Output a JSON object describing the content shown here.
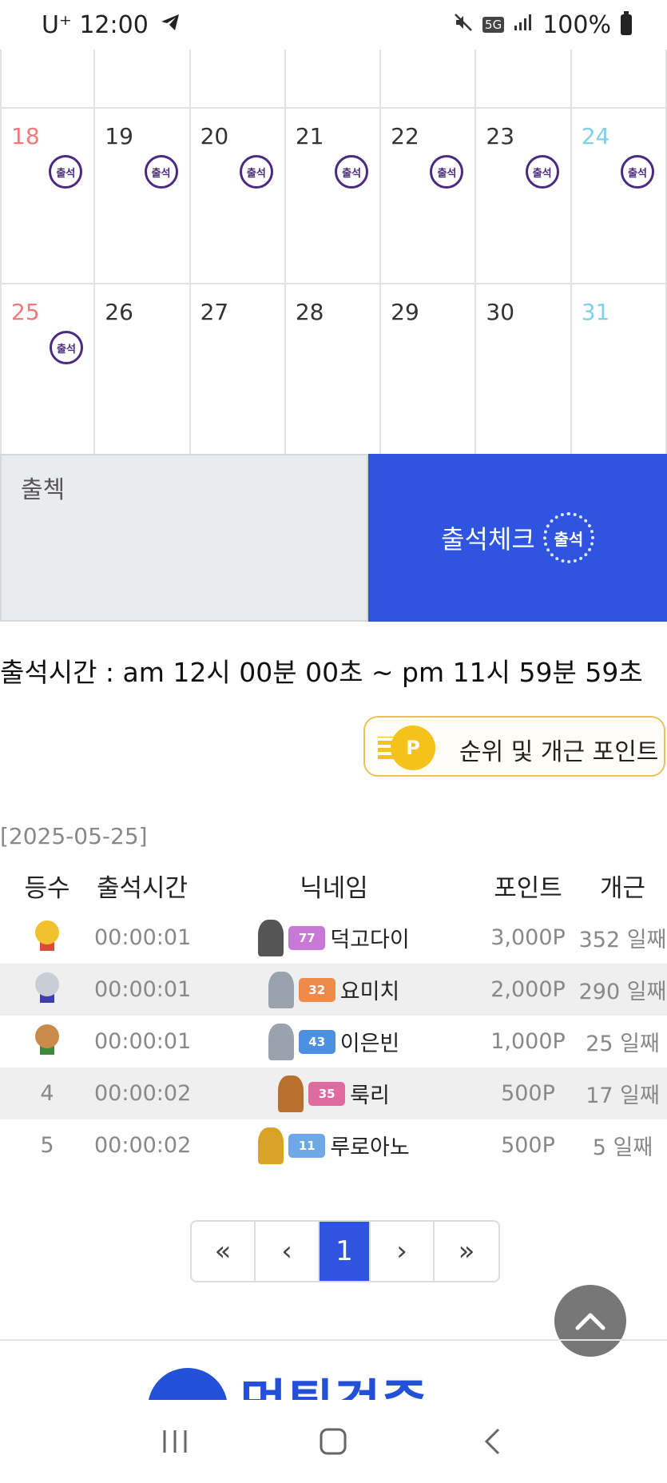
{
  "status_bar": {
    "carrier": "U⁺ 12:00",
    "network": "5G",
    "battery": "100%"
  },
  "calendar": {
    "week_a": [
      {
        "day": "18",
        "kind": "sun",
        "stamp": true
      },
      {
        "day": "19",
        "kind": "weekday",
        "stamp": true
      },
      {
        "day": "20",
        "kind": "weekday",
        "stamp": true
      },
      {
        "day": "21",
        "kind": "weekday",
        "stamp": true
      },
      {
        "day": "22",
        "kind": "weekday",
        "stamp": true
      },
      {
        "day": "23",
        "kind": "weekday",
        "stamp": true
      },
      {
        "day": "24",
        "kind": "sat",
        "stamp": true
      }
    ],
    "week_b": [
      {
        "day": "25",
        "kind": "sun",
        "stamp": true
      },
      {
        "day": "26",
        "kind": "weekday",
        "stamp": false
      },
      {
        "day": "27",
        "kind": "weekday",
        "stamp": false
      },
      {
        "day": "28",
        "kind": "weekday",
        "stamp": false
      },
      {
        "day": "29",
        "kind": "weekday",
        "stamp": false
      },
      {
        "day": "30",
        "kind": "weekday",
        "stamp": false
      },
      {
        "day": "31",
        "kind": "sat",
        "stamp": false
      }
    ],
    "stamp_text": "출석"
  },
  "attendance": {
    "input_value": "출첵",
    "button_label": "출석체크",
    "seal_text": "출석"
  },
  "time_note": "출석시간 : am 12시 00분 00초 ~ pm 11시 59분 59초",
  "rank_button": {
    "label": "순위 및 개근 포인트",
    "coin_letter": "P"
  },
  "date_label": "[2025-05-25]",
  "table": {
    "headers": {
      "rank": "등수",
      "time": "출석시간",
      "nickname": "닉네임",
      "points": "포인트",
      "days": "개근"
    },
    "rows": [
      {
        "rank": "1",
        "medal": "gold",
        "time": "00:00:01",
        "level": "77",
        "level_color": "#c879d8",
        "nickname": "덕고다이",
        "points": "3,000P",
        "days": "352 일째",
        "avatar": "#555555"
      },
      {
        "rank": "2",
        "medal": "silver",
        "time": "00:00:01",
        "level": "32",
        "level_color": "#ef8a4a",
        "nickname": "요미치",
        "points": "2,000P",
        "days": "290 일째",
        "avatar": "#9aa3ad"
      },
      {
        "rank": "3",
        "medal": "bronze",
        "time": "00:00:01",
        "level": "43",
        "level_color": "#4d8fe0",
        "nickname": "이은빈",
        "points": "1,000P",
        "days": "25 일째",
        "avatar": "#9aa3ad"
      },
      {
        "rank": "4",
        "medal": "",
        "time": "00:00:02",
        "level": "35",
        "level_color": "#e06aa0",
        "nickname": "룩리",
        "points": "500P",
        "days": "17 일째",
        "avatar": "#b8702c"
      },
      {
        "rank": "5",
        "medal": "",
        "time": "00:00:02",
        "level": "11",
        "level_color": "#6fa8e6",
        "nickname": "루로아노",
        "points": "500P",
        "days": "5 일째",
        "avatar": "#d9a326"
      }
    ]
  },
  "pagination": {
    "first": "«",
    "prev": "‹",
    "current": "1",
    "next": "›",
    "last": "»"
  },
  "footer": {
    "logo_text": "먹튀검증"
  },
  "colors": {
    "accent_blue": "#2f55e0",
    "sunday": "#f07a7a",
    "saturday": "#7fd0ea"
  }
}
